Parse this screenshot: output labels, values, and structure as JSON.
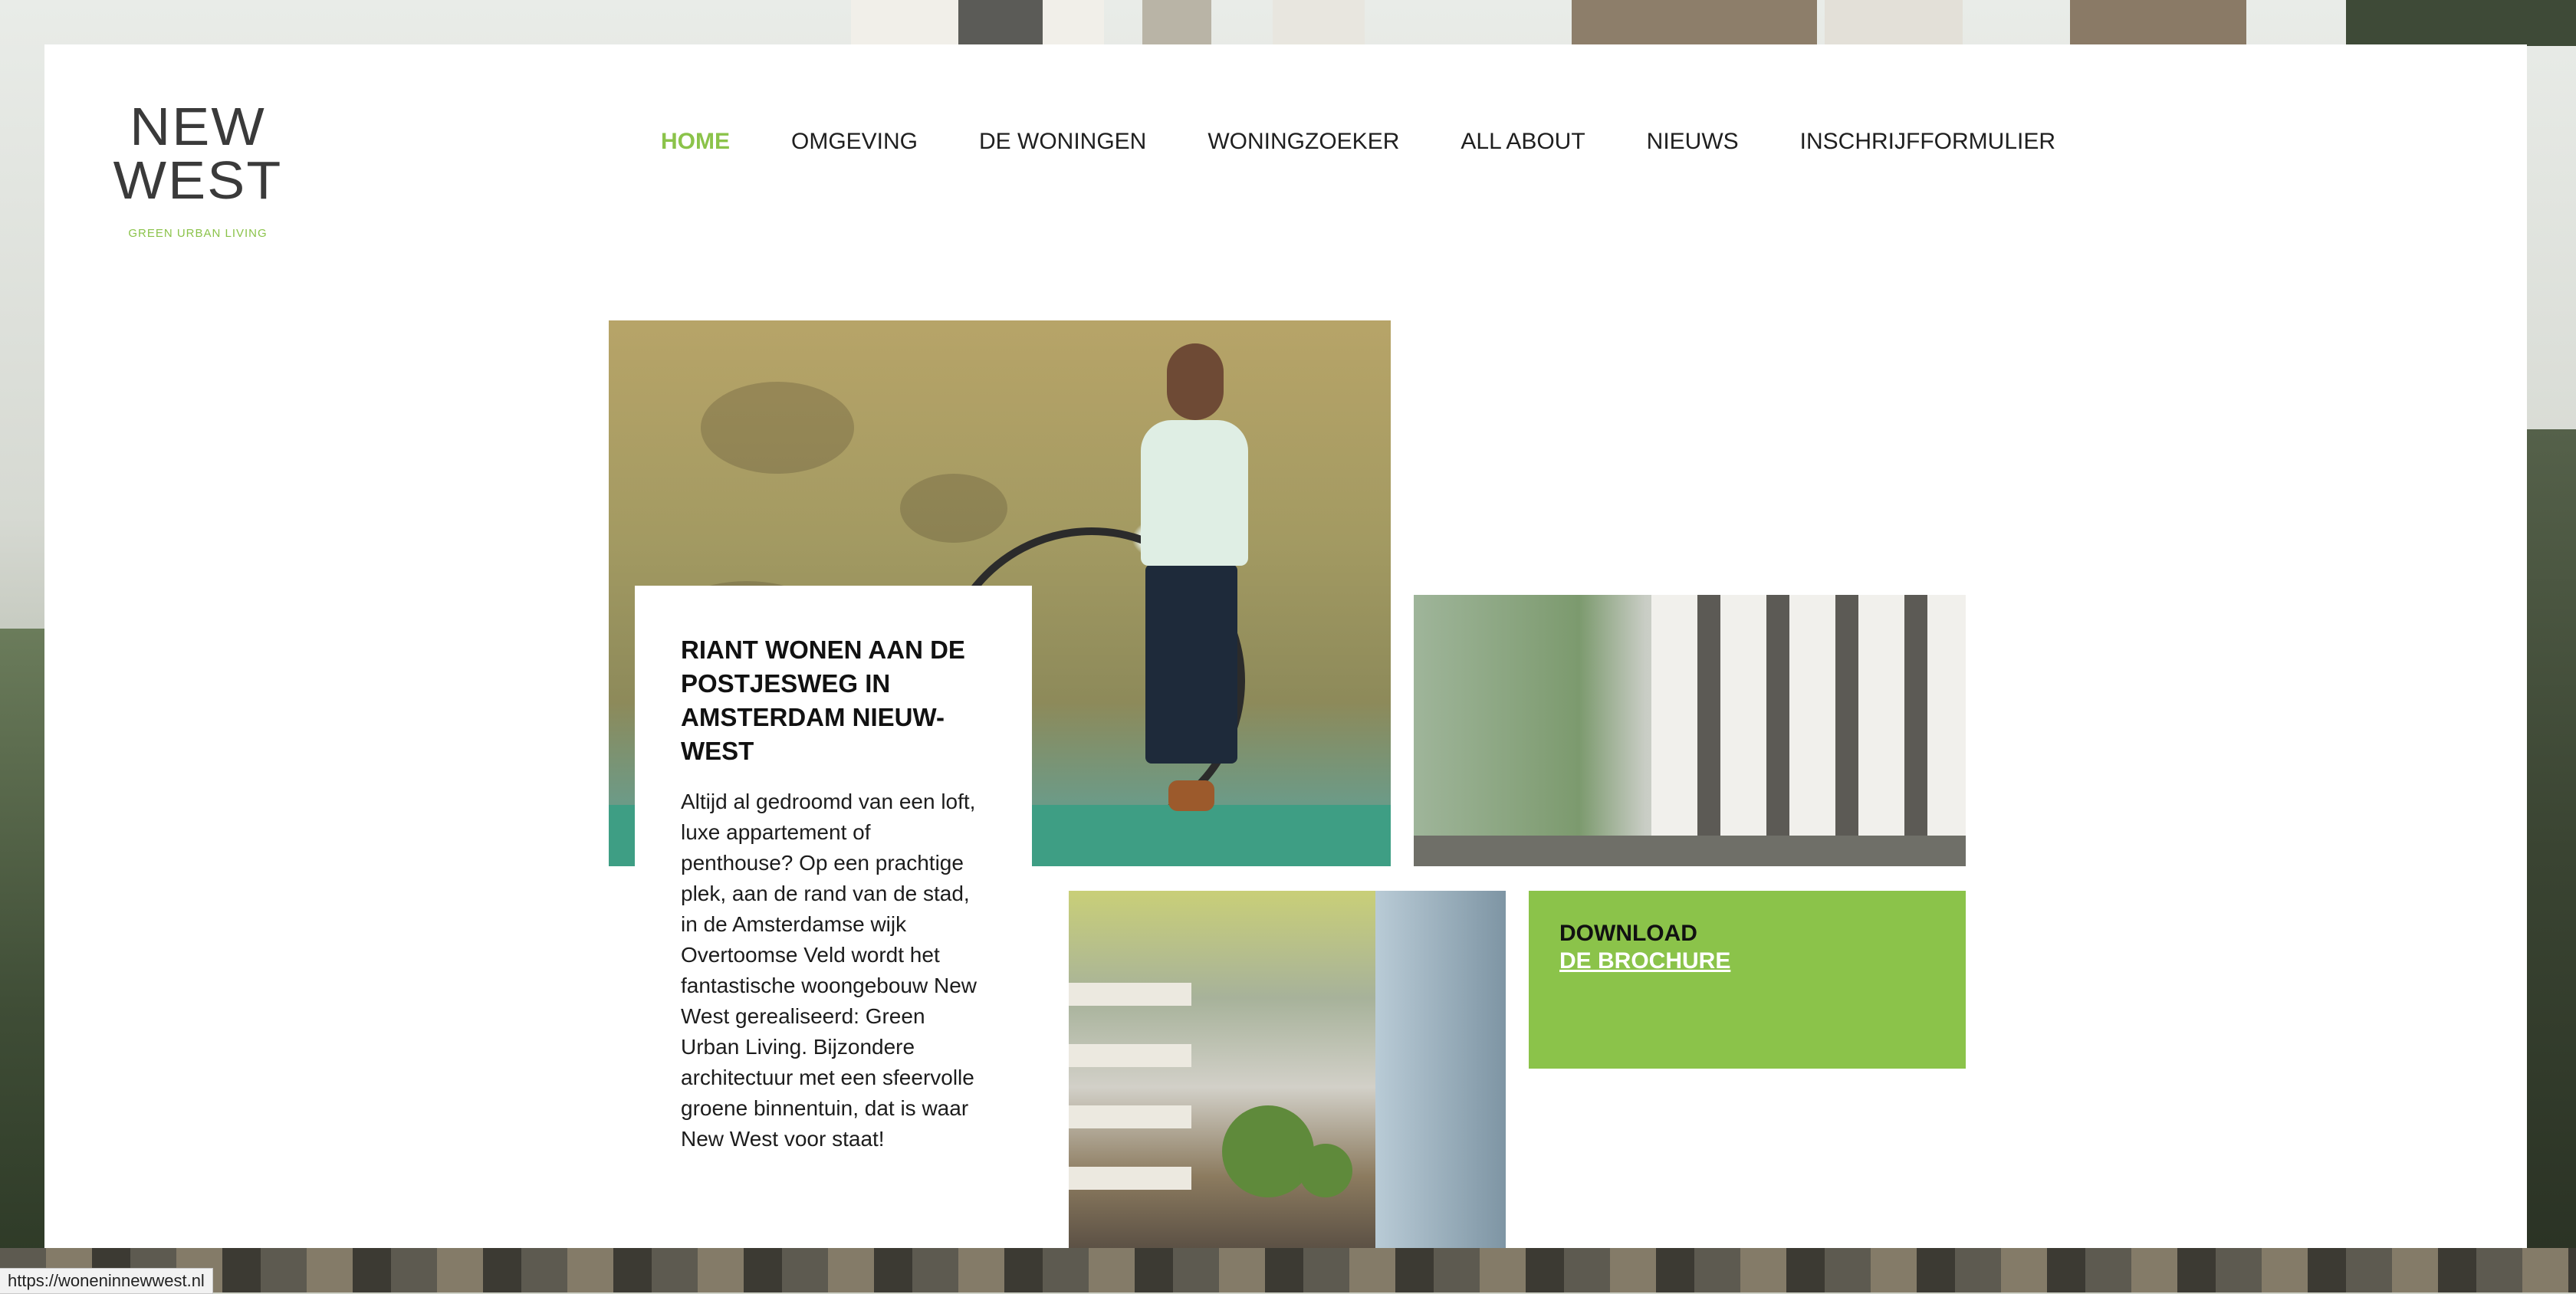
{
  "nav": {
    "items": [
      {
        "label": "HOME",
        "active": true
      },
      {
        "label": "OMGEVING"
      },
      {
        "label": "DE WONINGEN"
      },
      {
        "label": "WONINGZOEKER"
      },
      {
        "label": "ALL ABOUT"
      },
      {
        "label": "NIEUWS"
      },
      {
        "label": "INSCHRIJFFORMULIER"
      }
    ]
  },
  "logo": {
    "line1": "NEW",
    "line2": "WEST",
    "tagline": "GREEN URBAN LIVING"
  },
  "intro": {
    "heading": "RIANT WONEN AAN DE POSTJESWEG IN AMSTERDAM NIEUW-WEST",
    "body": "Altijd al gedroomd van een loft, luxe appartement of penthouse? Op een prachtige plek, aan de rand van de stad, in de Amsterdamse wijk Overtoomse Veld wordt het fantastische woongebouw New West gerealiseerd: Green Urban Living. Bijzondere architectuur met een sfeervolle groene binnentuin, dat is waar New West voor staat!"
  },
  "cta": {
    "line1": "DOWNLOAD",
    "line2": "DE BROCHURE"
  },
  "status_bar": {
    "url": "https://woneninnewwest.nl"
  },
  "colors": {
    "accent": "#8bc34a",
    "text": "#1f1f1f"
  },
  "icons": {}
}
